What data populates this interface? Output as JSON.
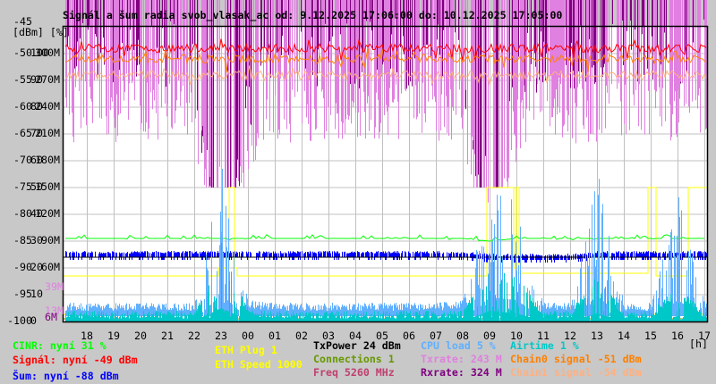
{
  "title": "Signál a šum radia svob_vlasak_ac od: 9.12.2025 17:06:00 do: 10.12.2025 17:05:00",
  "chart_data": {
    "type": "line",
    "title": "Signál a šum radia svob_vlasak_ac od: 9.12.2025 17:06:00 do: 10.12.2025 17:05:00",
    "ylabel": "[dBm] [%]",
    "xlabel": "[h]",
    "grid": true,
    "x_range_hours": [
      17.1,
      41.08
    ],
    "x_ticks": [
      "18",
      "19",
      "20",
      "21",
      "22",
      "23",
      "00",
      "01",
      "02",
      "03",
      "04",
      "05",
      "06",
      "07",
      "08",
      "09",
      "10",
      "11",
      "12",
      "13",
      "14",
      "15",
      "16",
      "17"
    ],
    "y_ticks_dbm": [
      "-45",
      "-50",
      "-55",
      "-60",
      "-65",
      "-70",
      "-75",
      "-80",
      "-85",
      "-90",
      "-95",
      "-100"
    ],
    "y_ticks_pct": [
      "",
      "100",
      "90",
      "80",
      "70",
      "60",
      "50",
      "40",
      "30",
      "20",
      "10",
      "0"
    ],
    "y_ticks_rate": [
      "",
      "300M",
      "270M",
      "240M",
      "210M",
      "180M",
      "150M",
      "120M",
      "90M",
      "60M",
      "",
      ""
    ],
    "ylim_dbm": [
      -100,
      -45
    ],
    "ylim_pct": [
      0,
      110
    ],
    "ylim_rate_mbps": [
      0,
      330
    ],
    "rate_min_markers": {
      "tx": "39M",
      "tx2": "13M",
      "rx": "6M"
    },
    "hours": [
      17,
      18,
      19,
      20,
      21,
      22,
      23,
      24,
      25,
      26,
      27,
      28,
      29,
      30,
      31,
      32,
      33,
      34,
      35,
      36,
      37,
      38,
      39,
      40,
      41
    ],
    "series": [
      {
        "name": "Signál",
        "unit": "dBm",
        "values": [
          -49,
          -49,
          -49,
          -49,
          -49,
          -49,
          -49,
          -49,
          -49,
          -49,
          -49,
          -49,
          -49,
          -49,
          -49,
          -49,
          -49,
          -49,
          -49,
          -49,
          -49,
          -49,
          -49,
          -49,
          -49
        ]
      },
      {
        "name": "Chain0 signal",
        "unit": "dBm",
        "values": [
          -51,
          -51,
          -51,
          -51,
          -51,
          -51,
          -51,
          -51,
          -51,
          -51,
          -51,
          -51,
          -51,
          -51,
          -51,
          -51,
          -51,
          -51,
          -51,
          -51,
          -51,
          -51,
          -51,
          -51,
          -51
        ]
      },
      {
        "name": "Chain1 signal",
        "unit": "dBm",
        "values": [
          -54,
          -54,
          -54,
          -54,
          -54,
          -54,
          -54,
          -54,
          -54,
          -54,
          -54,
          -54,
          -54,
          -54,
          -54,
          -54,
          -54,
          -54,
          -54,
          -54,
          -54,
          -54,
          -54,
          -54,
          -54
        ]
      },
      {
        "name": "Šum",
        "unit": "dBm",
        "values": [
          -88,
          -88,
          -88,
          -88,
          -88,
          -88,
          -88,
          -88,
          -88,
          -88,
          -88,
          -88,
          -88,
          -88,
          -88,
          -88,
          -88.5,
          -88.5,
          -88.5,
          -88.5,
          -88,
          -88,
          -88,
          -88,
          -88
        ]
      },
      {
        "name": "CINR",
        "unit": "%",
        "values": [
          31,
          31,
          31,
          31,
          31,
          31,
          31,
          31,
          31,
          31,
          31,
          31,
          31,
          31,
          31,
          31,
          30,
          31,
          31,
          31,
          31,
          31,
          31,
          31,
          31
        ]
      },
      {
        "name": "CPU load",
        "unit": "%",
        "values": [
          4,
          4,
          4,
          4,
          4,
          4,
          50,
          5,
          4,
          4,
          4,
          4,
          4,
          4,
          4,
          5,
          45,
          40,
          4,
          4,
          48,
          4,
          4,
          40,
          5
        ]
      },
      {
        "name": "Airtime",
        "unit": "%",
        "values": [
          1,
          1,
          1,
          1,
          1,
          1,
          25,
          2,
          1,
          1,
          1,
          1,
          1,
          1,
          1,
          1,
          20,
          15,
          1,
          1,
          15,
          1,
          1,
          10,
          1
        ]
      },
      {
        "name": "Txrate",
        "unit": "Mbps",
        "values": [
          240,
          240,
          240,
          240,
          240,
          240,
          39,
          200,
          240,
          240,
          240,
          240,
          240,
          240,
          240,
          240,
          39,
          220,
          240,
          240,
          230,
          240,
          240,
          240,
          243
        ]
      },
      {
        "name": "Rxrate",
        "unit": "Mbps",
        "values": [
          300,
          300,
          300,
          300,
          300,
          300,
          6,
          250,
          300,
          300,
          300,
          300,
          300,
          300,
          300,
          300,
          6,
          280,
          300,
          300,
          300,
          300,
          300,
          300,
          324
        ]
      },
      {
        "name": "ETH",
        "unit": "%",
        "steps": [
          [
            17.1,
            17
          ],
          [
            22.9,
            20
          ],
          [
            23.3,
            50
          ],
          [
            23.5,
            20
          ],
          [
            23.6,
            17
          ],
          [
            32.9,
            50
          ],
          [
            33.9,
            20
          ],
          [
            34.0,
            50
          ],
          [
            34.1,
            18
          ],
          [
            38.9,
            50
          ],
          [
            39.2,
            17
          ],
          [
            40.4,
            50
          ],
          [
            41.0,
            50
          ]
        ]
      }
    ]
  },
  "legend": {
    "cinr": "CINR: nyní 31 %",
    "signal": "Signál: nyní -49 dBm",
    "noise": "Šum: nyní -88 dBm",
    "eth_plug": "ETH Plug 1",
    "eth_speed": "ETH Speed 1000",
    "txpower": "TxPower 24 dBm",
    "connections": "Connections 1",
    "freq": "Freq 5260 MHz",
    "cpu": "CPU load 5 %",
    "txrate": "Txrate: 243 M",
    "rxrate": "Rxrate: 324 M",
    "airtime": "Airtime 1 %",
    "chain0": "Chain0 signal -51 dBm",
    "chain1": "Chain1 signal -54 dBm"
  },
  "colors": {
    "signal": "#ff0000",
    "chain0": "#ff8000",
    "chain1": "#ffb080",
    "noise": "#0000ff",
    "cinr": "#00ff00",
    "cpu": "#60b0ff",
    "airtime": "#00c8c8",
    "txrate": "#e080e0",
    "rxrate": "#800080",
    "eth": "#ffff00",
    "connections": "#669900",
    "freq": "#c04070",
    "txpower": "#000000",
    "grid": "#c0c0c0"
  }
}
